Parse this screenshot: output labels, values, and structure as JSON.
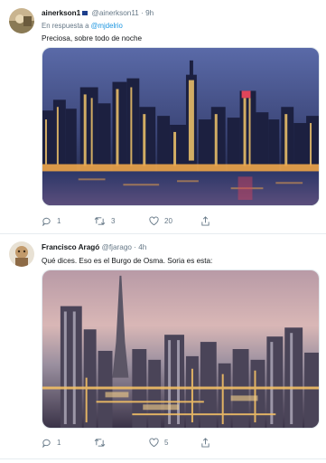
{
  "tweets": [
    {
      "author_name": "ainerkson1",
      "author_handle": "@ainerkson11",
      "time": "· 9h",
      "reply_prefix": "En respuesta a",
      "reply_mention": "@mjdelrio",
      "text": "Preciosa, sobre todo de noche",
      "stats": {
        "replies": "1",
        "retweets": "3",
        "likes": "20"
      },
      "media_icon": "city-night-photo"
    },
    {
      "author_name": "Francisco Aragó",
      "author_handle": "@fjarago",
      "time": "· 4h",
      "text": "Qué dices. Eso es el Burgo de Osma. Soria es esta:",
      "stats": {
        "replies": "1",
        "retweets": "",
        "likes": "5"
      },
      "media_icon": "dubai-skyline-photo"
    }
  ],
  "colors": {
    "link": "#1b95e0",
    "secondary_text": "#657786",
    "separator": "#e6ecf0"
  }
}
